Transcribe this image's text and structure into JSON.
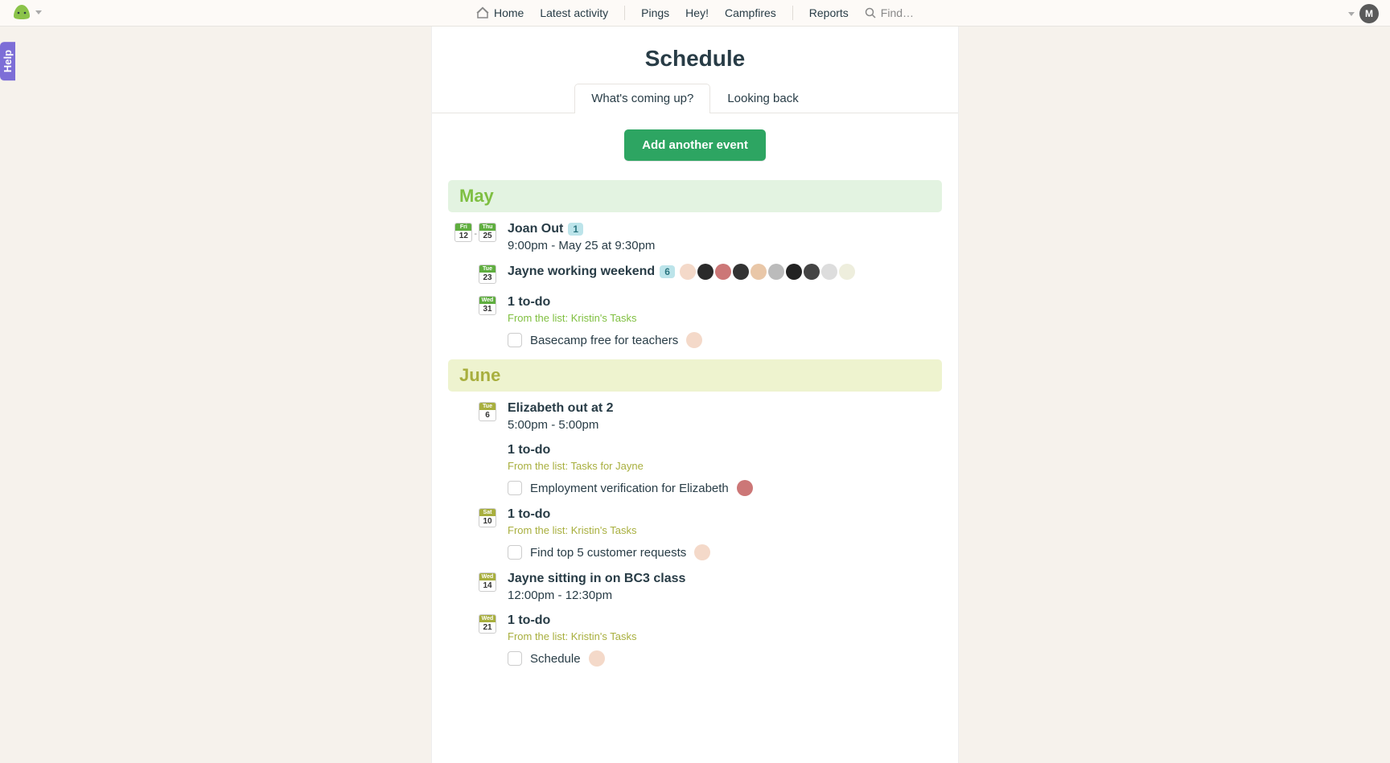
{
  "nav": {
    "home": "Home",
    "latest": "Latest activity",
    "pings": "Pings",
    "hey": "Hey!",
    "campfires": "Campfires",
    "reports": "Reports",
    "find": "Find…"
  },
  "help": "Help",
  "avatar_initial": "M",
  "page_title": "Schedule",
  "tabs": {
    "upcoming": "What's coming up?",
    "back": "Looking back"
  },
  "add_event_btn": "Add another event",
  "months": {
    "may": "May",
    "june": "June"
  },
  "may_entries": {
    "e1": {
      "dow1": "Fri",
      "num1": "12",
      "dow2": "Thu",
      "num2": "25",
      "title": "Joan Out",
      "badge": "1",
      "sub": "9:00pm - May 25 at 9:30pm"
    },
    "e2": {
      "dow": "Tue",
      "num": "23",
      "title": "Jayne working weekend",
      "badge": "6"
    },
    "e3": {
      "dow": "Wed",
      "num": "31",
      "title": "1 to-do",
      "from": "From the list: Kristin's Tasks",
      "todo": "Basecamp free for teachers"
    }
  },
  "june_entries": {
    "e1": {
      "dow": "Tue",
      "num": "6",
      "title": "Elizabeth out at 2",
      "sub": "5:00pm - 5:00pm"
    },
    "e2": {
      "title": "1 to-do",
      "from": "From the list: Tasks for Jayne",
      "todo": "Employment verification for Elizabeth"
    },
    "e3": {
      "dow": "Sat",
      "num": "10",
      "title": "1 to-do",
      "from": "From the list: Kristin's Tasks",
      "todo": "Find top 5 customer requests"
    },
    "e4": {
      "dow": "Wed",
      "num": "14",
      "title": "Jayne sitting in on BC3 class",
      "sub": "12:00pm - 12:30pm"
    },
    "e5": {
      "dow": "Wed",
      "num": "21",
      "title": "1 to-do",
      "from": "From the list: Kristin's Tasks",
      "todo": "Schedule"
    }
  }
}
